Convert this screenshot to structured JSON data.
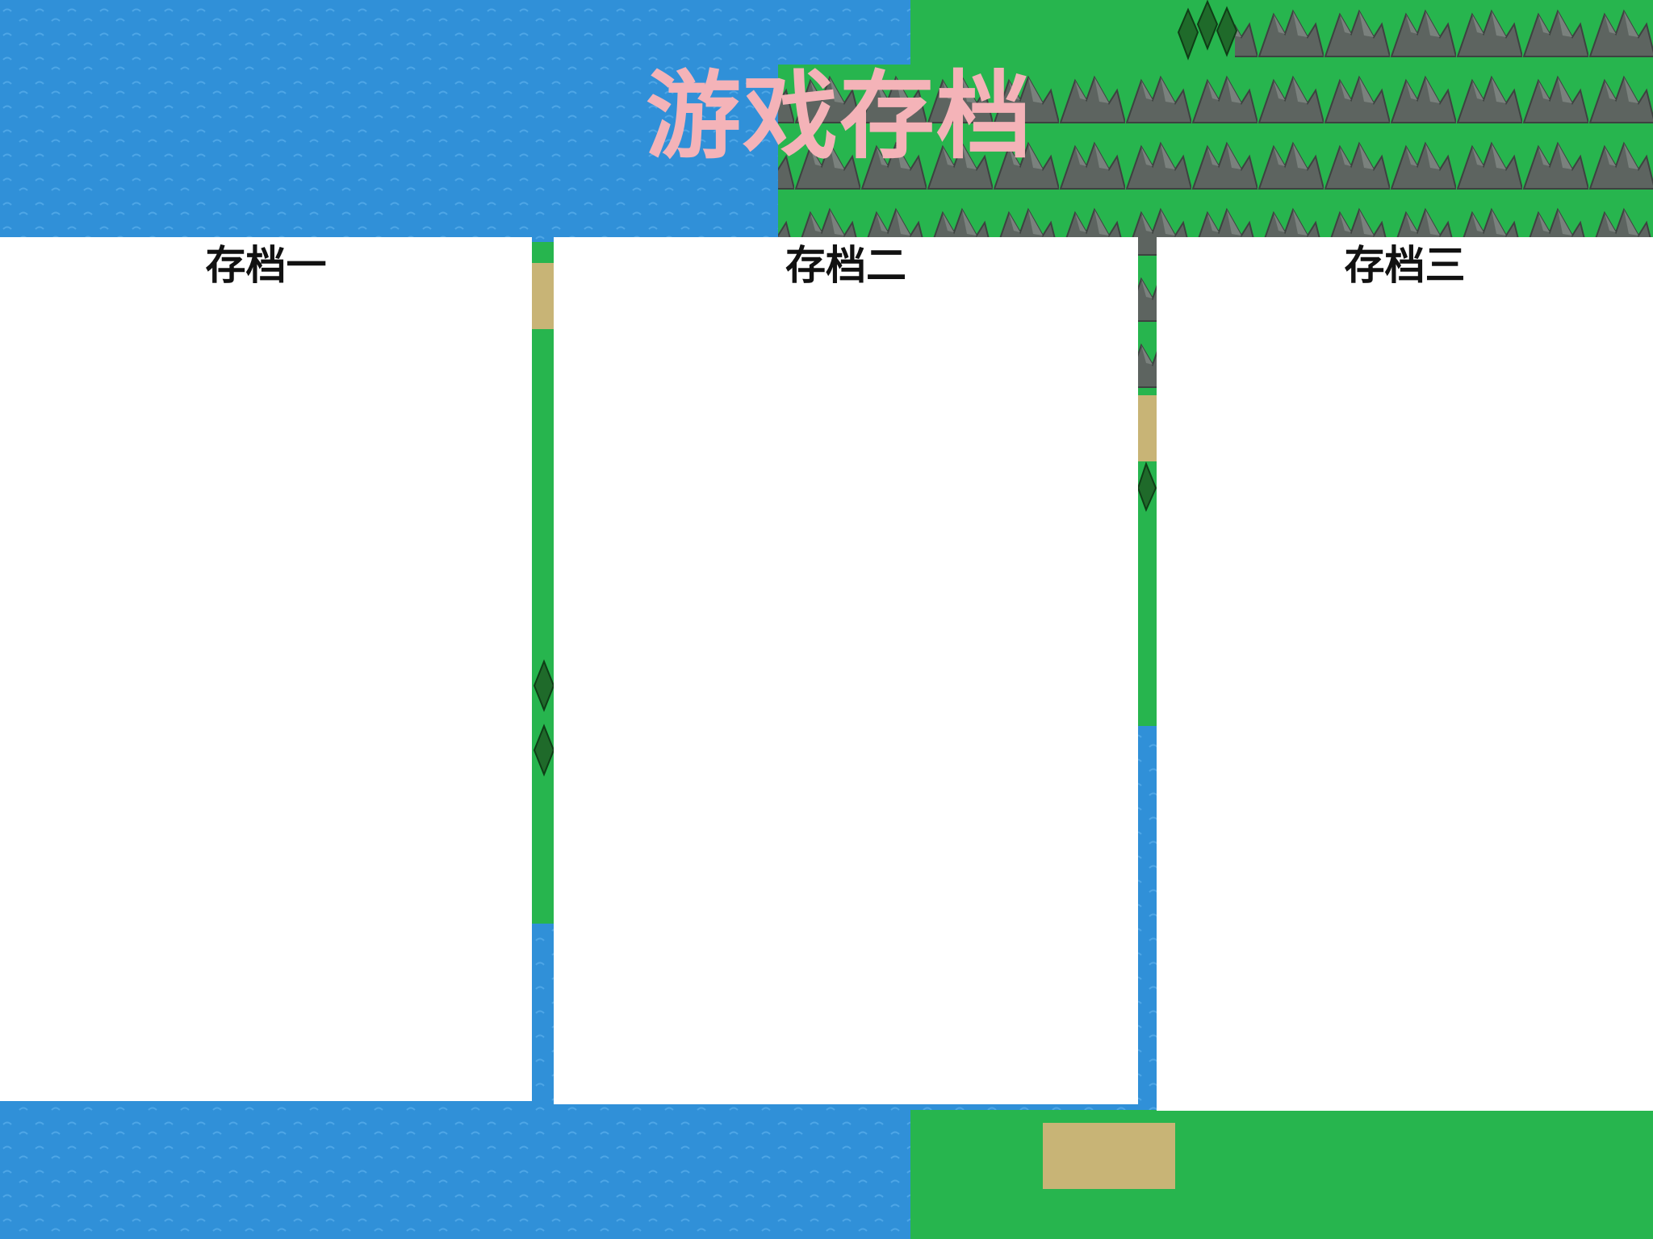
{
  "screen": {
    "title": "游戏存档",
    "title_color": "#f4b3b8"
  },
  "slots": [
    {
      "label": "存档一"
    },
    {
      "label": "存档二"
    },
    {
      "label": "存档三"
    }
  ],
  "terrain_colors": {
    "water": "#3090d8",
    "grass": "#27b54e",
    "sand": "#c8b476",
    "mountain": "#5d6460",
    "tree": "#1f6a2a"
  }
}
